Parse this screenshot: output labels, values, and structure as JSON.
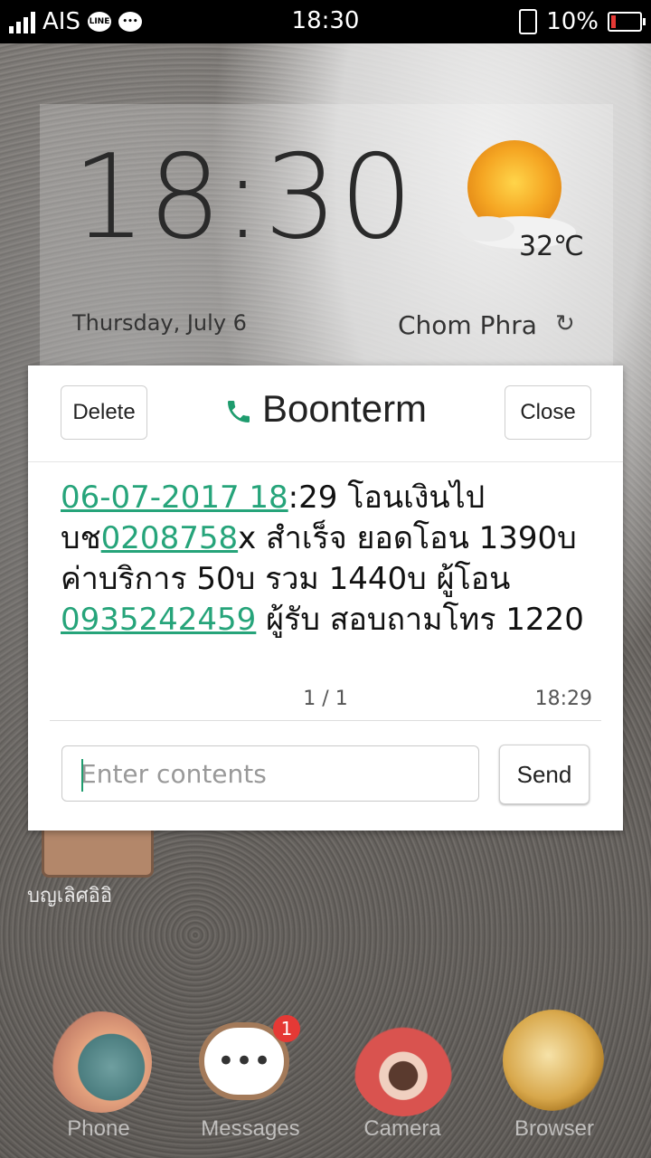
{
  "status_bar": {
    "carrier": "AIS",
    "chat_badge": "LINE",
    "time": "18:30",
    "battery": "10%",
    "battery_level": 0.1
  },
  "clock_widget": {
    "time": "18:30",
    "temperature": "32℃",
    "date": "Thursday, July 6",
    "location": "Chom Phra"
  },
  "dialog": {
    "delete_label": "Delete",
    "close_label": "Close",
    "contact_name": "Boonterm",
    "message": {
      "link_date": "06-07-2017 18",
      "text_1": ":29 โอนเงินไป บช",
      "link_account": "0208758",
      "text_2": "x สำเร็จ ยอดโอน 1390บ ค่าบริการ 50บ รวม 1440บ ผู้โอน ",
      "link_phone": "0935242459",
      "text_3": " ผู้รับ  สอบถามโทร 1220"
    },
    "page_count": "1 / 1",
    "time": "18:29",
    "input_placeholder": "Enter contents",
    "send_label": "Send"
  },
  "home": {
    "folder_label": "บญเลิศอิอิ",
    "dock": [
      {
        "label": "Phone",
        "icon": "snail-phone-icon"
      },
      {
        "label": "Messages",
        "icon": "messages-icon",
        "badge": "1"
      },
      {
        "label": "Camera",
        "icon": "camera-icon"
      },
      {
        "label": "Browser",
        "icon": "browser-icon"
      }
    ]
  },
  "colors": {
    "link": "#26a47a",
    "status_bar": "#000000",
    "badge": "#e53935"
  }
}
